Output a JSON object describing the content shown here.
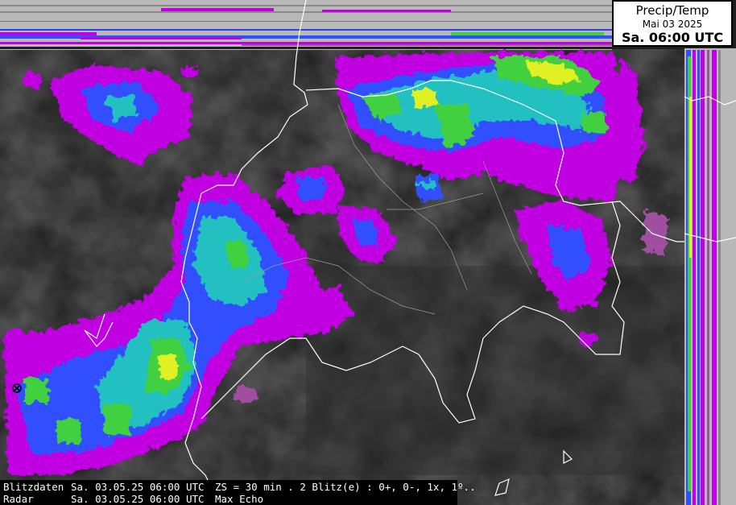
{
  "title": {
    "product": "Precip/Temp",
    "date": "Mai 03 2025",
    "time": "Sa. 06:00 UTC"
  },
  "info_rows": [
    {
      "label": "Blitzdaten",
      "timestamp": "Sa. 03.05.25 06:00 UTC",
      "detail": "ZS = 30 min . 2 Blitz(e) : 0+, 0-, 1x, 1º.."
    },
    {
      "label": "Radar",
      "timestamp": "Sa. 03.05.25 06:00 UTC",
      "detail": "Max Echo"
    }
  ],
  "colors": {
    "background": "#1e1e1e",
    "precip_light": "#a050a0",
    "precip_magenta": "#c000e0",
    "precip_blue": "#3050ff",
    "precip_cyan": "#20c0c0",
    "precip_green": "#40d040",
    "precip_yellow": "#e0f020",
    "borders": "#ffffff"
  },
  "lightning_marker": "lightning-icon"
}
